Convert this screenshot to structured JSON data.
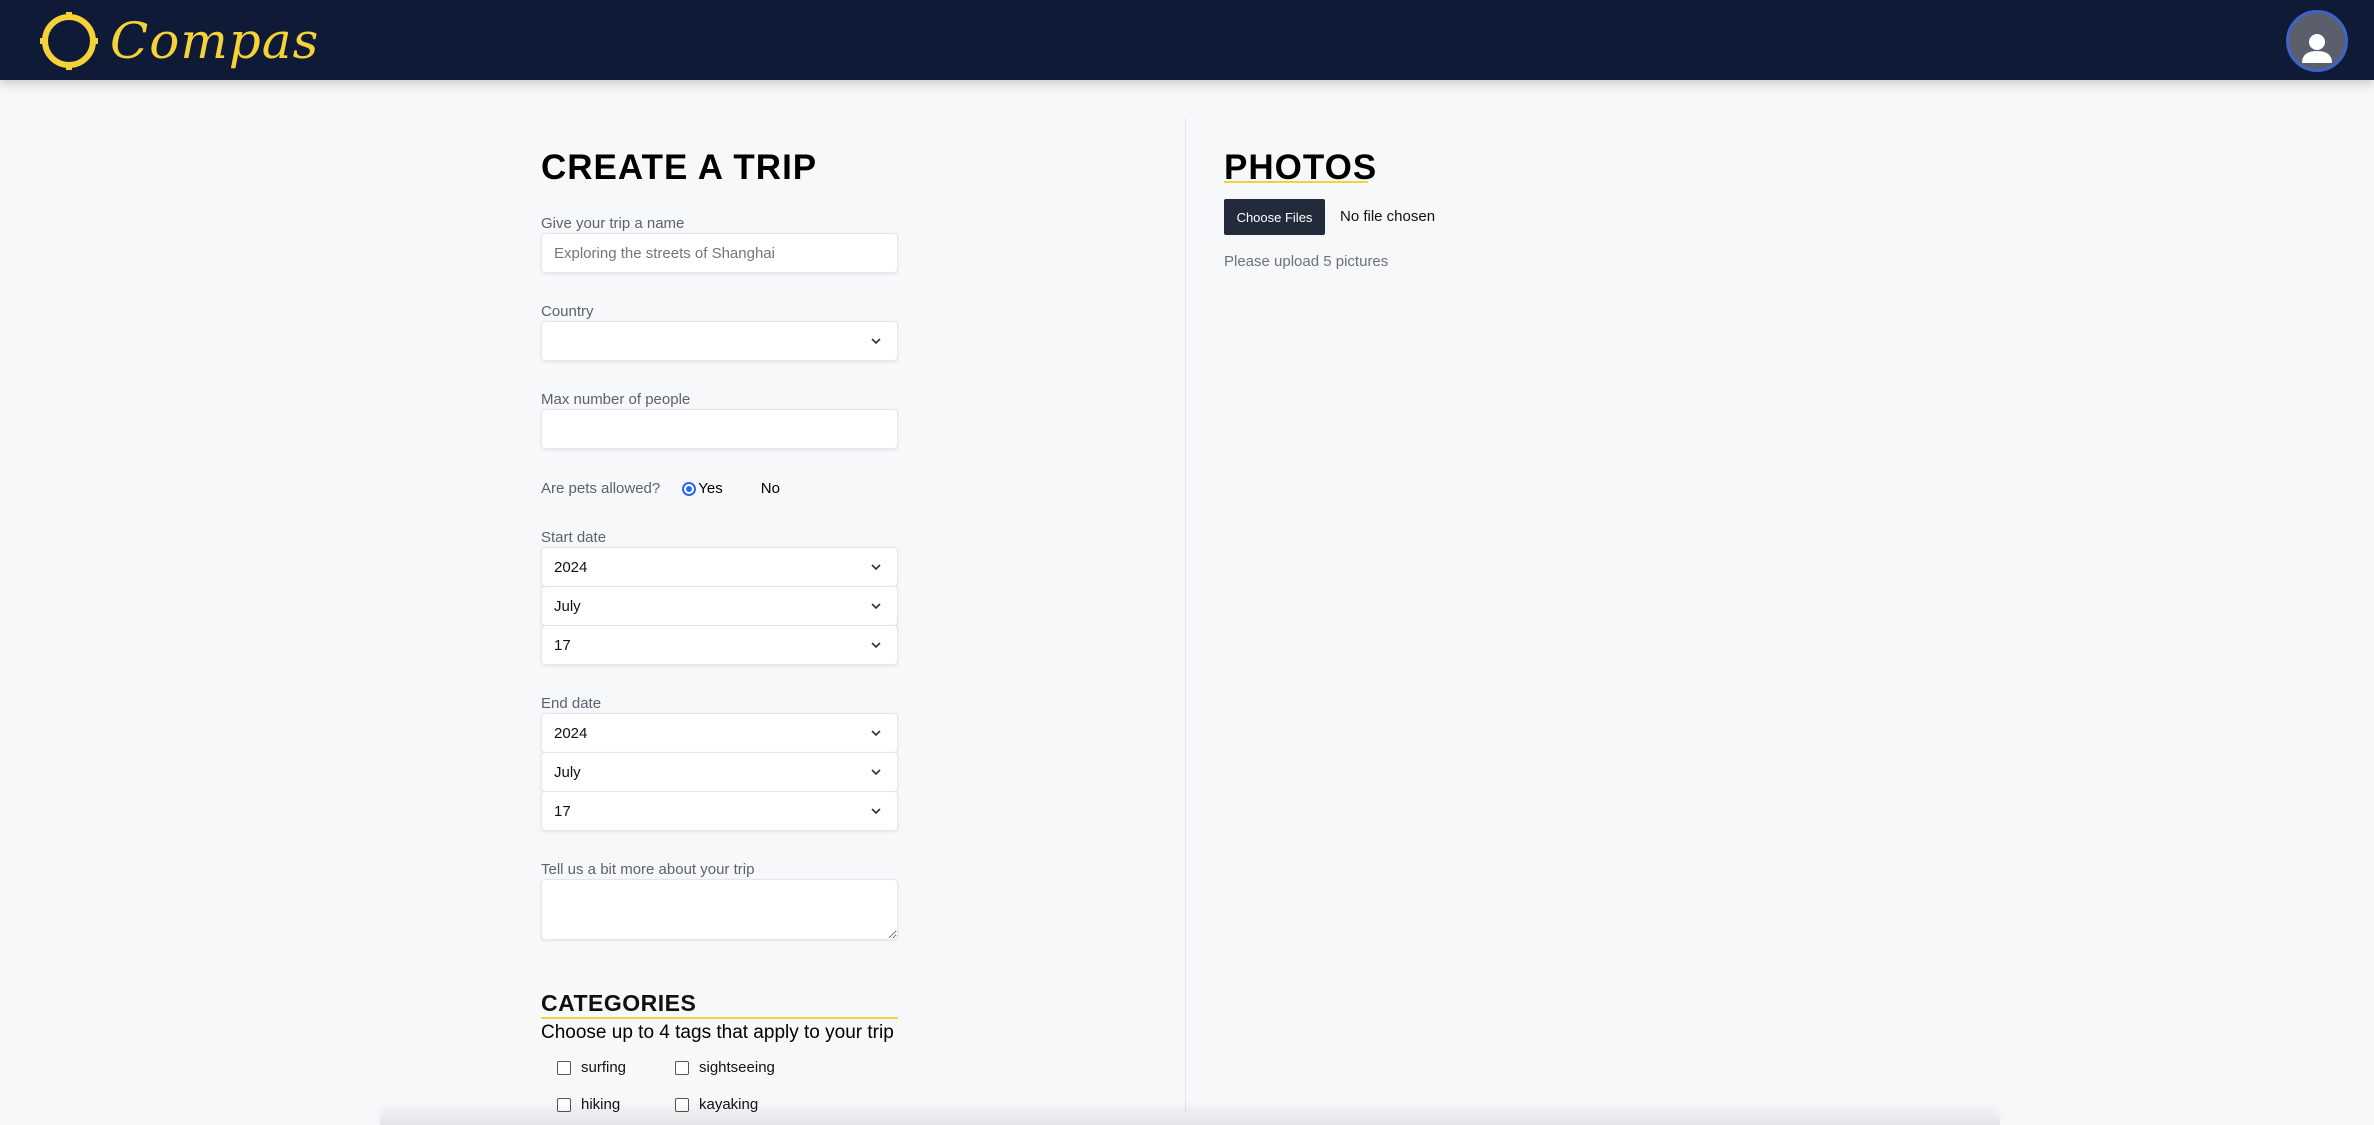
{
  "app": {
    "logo_text": "Compas",
    "brand_color": "#f5d23a",
    "header_color": "#0f1b36"
  },
  "header": {
    "avatar_icon": "user-avatar-icon"
  },
  "form": {
    "title": "CREATE A TRIP",
    "trip_name": {
      "label": "Give your trip a name",
      "placeholder": "Exploring the streets of Shanghai"
    },
    "country": {
      "label": "Country",
      "value": ""
    },
    "max_people": {
      "label": "Max number of people",
      "value": ""
    },
    "pets": {
      "question": "Are pets allowed?",
      "yes_label": "Yes",
      "no_label": "No",
      "selected": "Yes"
    },
    "start_date": {
      "label": "Start date",
      "year": "2024",
      "month": "July",
      "day": "17"
    },
    "end_date": {
      "label": "End date",
      "year": "2024",
      "month": "July",
      "day": "17"
    },
    "description": {
      "label": "Tell us a bit more about your trip",
      "value": ""
    }
  },
  "categories": {
    "title": "CATEGORIES",
    "subtitle": "Choose up to 4 tags that apply to your trip",
    "tags": [
      "surfing",
      "sightseeing",
      "hiking",
      "kayaking"
    ]
  },
  "photos": {
    "title": "PHOTOS",
    "button_label": "Choose Files",
    "file_status": "No file chosen",
    "hint": "Please upload 5 pictures"
  }
}
